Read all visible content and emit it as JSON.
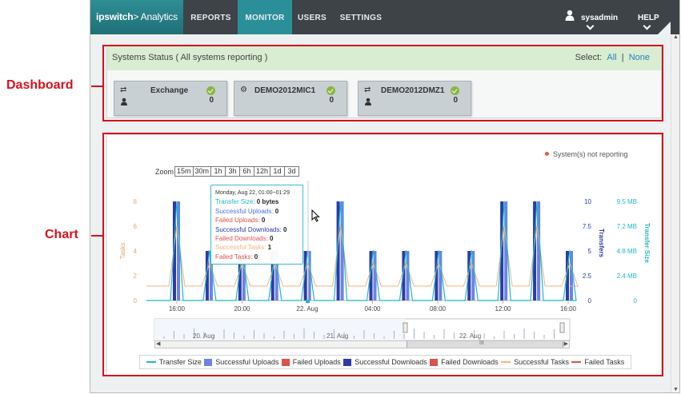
{
  "annotations": {
    "dashboard_label": "Dashboard",
    "chart_label": "Chart"
  },
  "topnav": {
    "brand": "ipswitch",
    "brand_sub": "> Analytics",
    "tabs": [
      {
        "label": "REPORTS"
      },
      {
        "label": "MONITOR",
        "active": true
      },
      {
        "label": "USERS"
      },
      {
        "label": "SETTINGS"
      }
    ],
    "user": "sysadmin",
    "help": "HELP"
  },
  "status": {
    "title": "Systems Status ( All systems reporting )",
    "select_label": "Select:",
    "select_all": "All",
    "select_sep": "|",
    "select_none": "None",
    "hosts": [
      {
        "name": "Exchange",
        "count": "0",
        "icon": "transfer-icon"
      },
      {
        "name": "DEMO2012MIC1",
        "count": "0",
        "icon": "gears-icon"
      },
      {
        "name": "DEMO2012DMZ1",
        "count": "0",
        "icon": "transfer-icon"
      }
    ]
  },
  "chart": {
    "zoom_label": "Zoom",
    "zoom_options": [
      "15m",
      "30m",
      "1h",
      "3h",
      "6h",
      "12h",
      "1d",
      "3d"
    ],
    "not_reporting": "System(s) not reporting",
    "tooltip": {
      "header": "Monday, Aug 22, 01:00~01:29",
      "rows": [
        {
          "label": "Transfer Size:",
          "value": "0 bytes",
          "color": "#1fb8c9"
        },
        {
          "label": "Successful Uploads:",
          "value": "0",
          "color": "#4a6ee0"
        },
        {
          "label": "Failed Uploads:",
          "value": "0",
          "color": "#d9534f"
        },
        {
          "label": "Successful Downloads:",
          "value": "0",
          "color": "#2c3aa8"
        },
        {
          "label": "Failed Downloads:",
          "value": "0",
          "color": "#d9534f"
        },
        {
          "label": "Successful Tasks:",
          "value": "1",
          "color": "#f7b27a"
        },
        {
          "label": "Failed Tasks:",
          "value": "0",
          "color": "#d9534f"
        }
      ]
    },
    "navigator_labels": [
      "20. Aug",
      "21. Aug",
      "22. Aug"
    ],
    "scroll_grip": "III",
    "legend": [
      {
        "label": "Transfer Size",
        "color": "#1fb8c9",
        "kind": "line"
      },
      {
        "label": "Successful Uploads",
        "color": "#6c82e6",
        "kind": "box"
      },
      {
        "label": "Failed Uploads",
        "color": "#d9534f",
        "kind": "box"
      },
      {
        "label": "Successful Downloads",
        "color": "#2c3aa8",
        "kind": "box"
      },
      {
        "label": "Failed Downloads",
        "color": "#d9534f",
        "kind": "box"
      },
      {
        "label": "Successful Tasks",
        "color": "#f7b27a",
        "kind": "line"
      },
      {
        "label": "Failed Tasks",
        "color": "#d9534f",
        "kind": "line"
      }
    ]
  },
  "chart_data": {
    "type": "bar",
    "x_tick_labels": [
      "16:00",
      "20:00",
      "22. Aug",
      "04:00",
      "08:00",
      "12:00",
      "16:00"
    ],
    "axes": {
      "tasks": {
        "label": "Tasks",
        "ticks": [
          "0",
          "2",
          "4",
          "6",
          "8"
        ],
        "ylim": [
          0,
          8
        ]
      },
      "transfers": {
        "label": "Transfers",
        "ticks": [
          "0",
          "2.5",
          "5",
          "7.5",
          "10"
        ],
        "ylim": [
          0,
          10
        ]
      },
      "transfer_size": {
        "label": "Transfer Size",
        "ticks": [
          "0",
          "2.4 MB",
          "4.8 MB",
          "7.2 MB",
          "9.5 MB"
        ],
        "ylim_mb": [
          0,
          9.5
        ]
      }
    },
    "series": [
      {
        "name": "Successful Downloads",
        "axis": "transfers",
        "values": [
          10,
          5,
          5,
          5,
          5,
          10,
          5,
          5,
          5,
          5,
          10,
          10,
          5
        ]
      },
      {
        "name": "Successful Uploads",
        "axis": "transfers",
        "values": [
          10,
          5,
          5,
          5,
          5,
          10,
          5,
          5,
          5,
          5,
          10,
          10,
          5
        ]
      },
      {
        "name": "Transfer Size",
        "axis": "transfer_size",
        "values": [
          9.5,
          4.8,
          4.8,
          4.8,
          4.8,
          9.5,
          4.8,
          4.8,
          4.8,
          4.8,
          9.5,
          9.5,
          4.8
        ]
      },
      {
        "name": "Successful Tasks",
        "axis": "tasks",
        "values": [
          6,
          3,
          3,
          3,
          3,
          6,
          3,
          3,
          3,
          3,
          6,
          6,
          3
        ]
      }
    ],
    "legend_position": "bottom",
    "grid": false
  }
}
